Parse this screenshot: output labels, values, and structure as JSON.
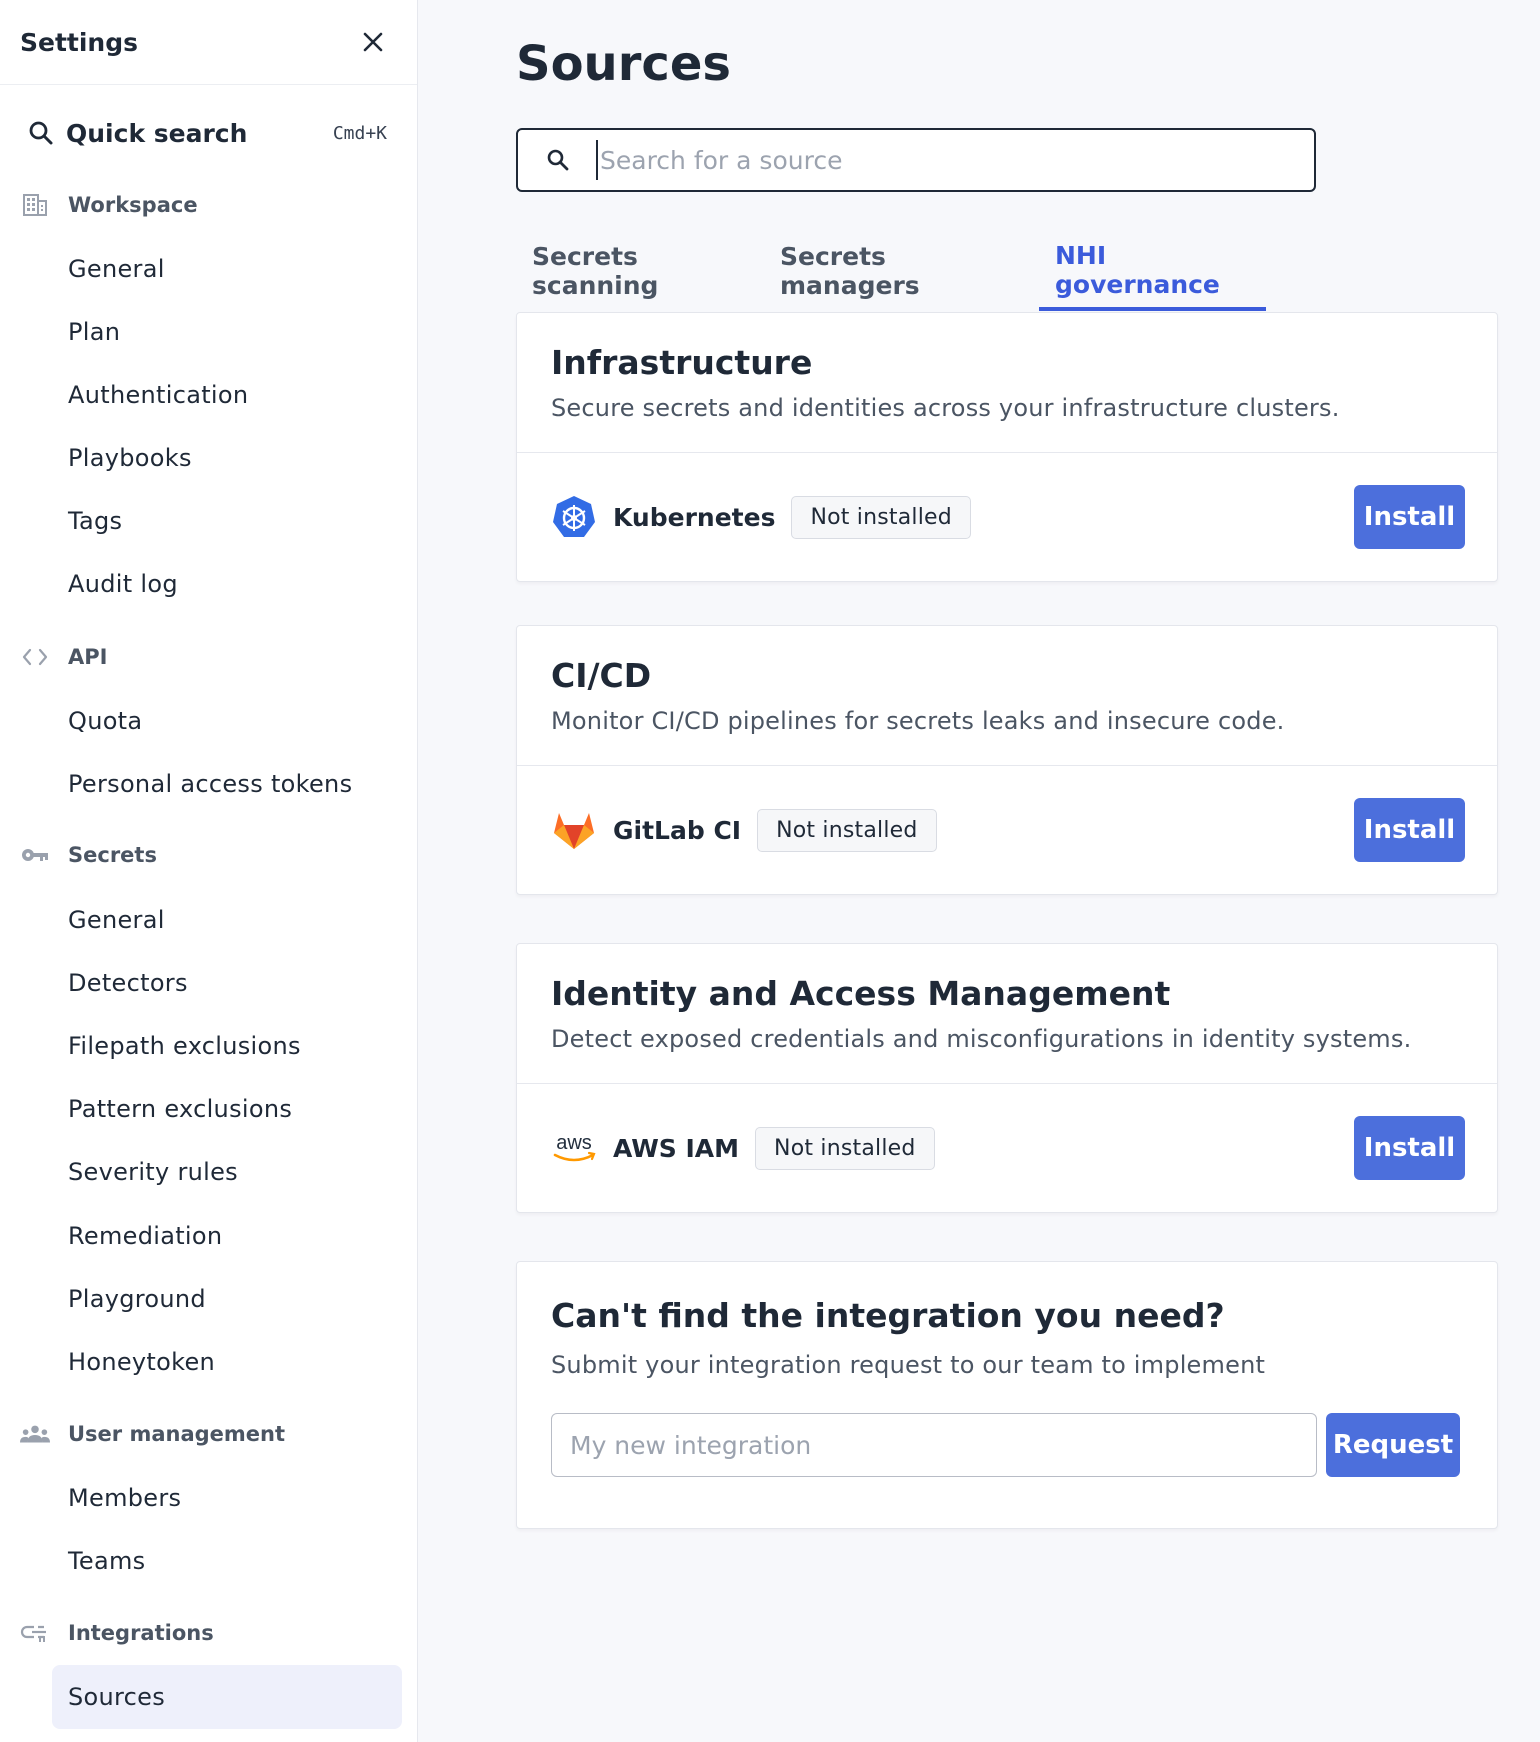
{
  "sidebar": {
    "title": "Settings",
    "quick_search": {
      "label": "Quick search",
      "shortcut": "Cmd+K"
    },
    "sections": [
      {
        "label": "Workspace",
        "icon": "building-icon",
        "items": [
          "General",
          "Plan",
          "Authentication",
          "Playbooks",
          "Tags",
          "Audit log"
        ]
      },
      {
        "label": "API",
        "icon": "code-icon",
        "items": [
          "Quota",
          "Personal access tokens"
        ]
      },
      {
        "label": "Secrets",
        "icon": "key-icon",
        "items": [
          "General",
          "Detectors",
          "Filepath exclusions",
          "Pattern exclusions",
          "Severity rules",
          "Remediation",
          "Playground",
          "Honeytoken"
        ]
      },
      {
        "label": "User management",
        "icon": "users-icon",
        "items": [
          "Members",
          "Teams"
        ]
      },
      {
        "label": "Integrations",
        "icon": "plug-icon",
        "items": [
          "Sources"
        ]
      }
    ],
    "active_item": "Sources"
  },
  "main": {
    "title": "Sources",
    "search": {
      "placeholder": "Search for a source",
      "value": ""
    },
    "tabs": [
      {
        "label": "Secrets scanning",
        "active": false
      },
      {
        "label": "Secrets managers",
        "active": false
      },
      {
        "label": "NHI governance",
        "active": true
      }
    ],
    "cards": [
      {
        "title": "Infrastructure",
        "description": "Secure secrets and identities across your infrastructure clusters.",
        "source": {
          "name": "Kubernetes",
          "icon": "kubernetes-icon",
          "status": "Not installed",
          "action": "Install"
        }
      },
      {
        "title": "CI/CD",
        "description": "Monitor CI/CD pipelines for secrets leaks and insecure code.",
        "source": {
          "name": "GitLab CI",
          "icon": "gitlab-icon",
          "status": "Not installed",
          "action": "Install"
        }
      },
      {
        "title": "Identity and Access Management",
        "description": "Detect exposed credentials and misconfigurations in identity systems.",
        "source": {
          "name": "AWS IAM",
          "icon": "aws-icon",
          "status": "Not installed",
          "action": "Install"
        }
      }
    ],
    "request": {
      "title": "Can't find the integration you need?",
      "description": "Submit your integration request to our team to implement",
      "placeholder": "My new integration",
      "button": "Request"
    }
  },
  "colors": {
    "accent": "#3b5bdb",
    "button": "#4c6fdc",
    "active_bg": "#eef0fb",
    "page_bg": "#f7f8fb"
  }
}
